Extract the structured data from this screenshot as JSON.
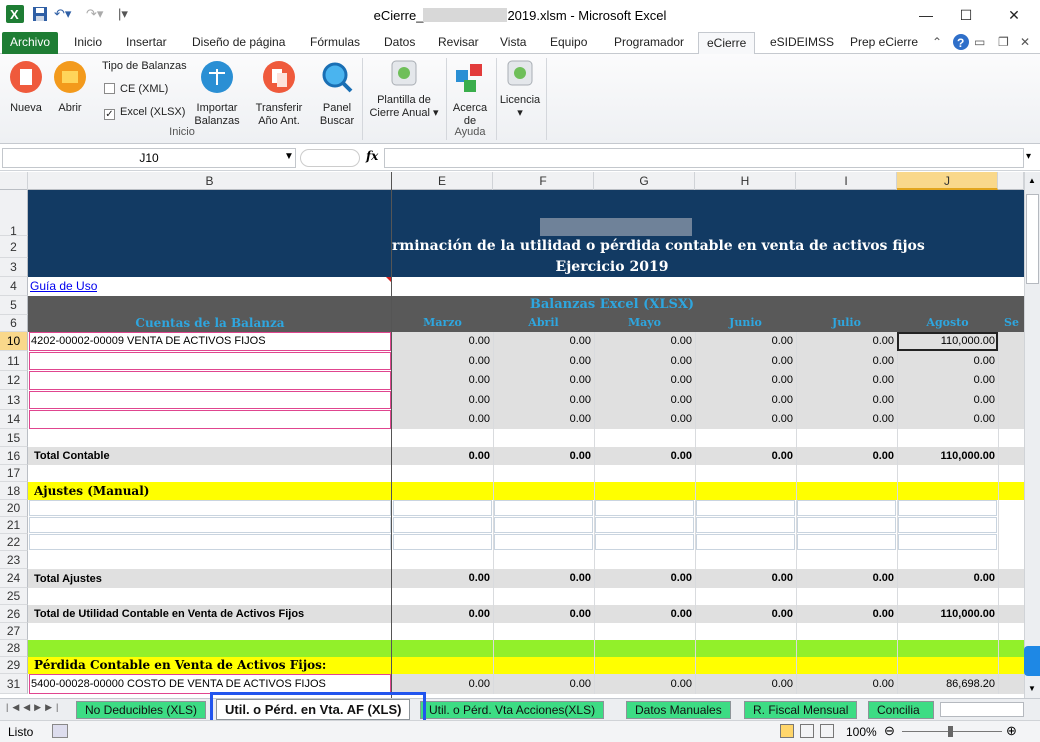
{
  "window": {
    "title_prefix": "eCierre_",
    "title_suffix": "2019.xlsm - Microsoft Excel",
    "minimize": "—",
    "maximize": "☐",
    "close": "✕"
  },
  "ribbon_tabs": [
    "Archivo",
    "Inicio",
    "Insertar",
    "Diseño de página",
    "Fórmulas",
    "Datos",
    "Revisar",
    "Vista",
    "Equipo",
    "Programador",
    "eCierre",
    "eSIDEIMSS",
    "Prep eCierre"
  ],
  "active_tab": "eCierre",
  "ribbon": {
    "nueva": "Nueva",
    "abrir": "Abrir",
    "tipo_balanzas": "Tipo de Balanzas",
    "ce_xml": "CE (XML)",
    "excel_xlsx": "Excel (XLSX)",
    "importar": [
      "Importar",
      "Balanzas"
    ],
    "transferir": [
      "Transferir",
      "Año Ant."
    ],
    "panel": [
      "Panel",
      "Buscar"
    ],
    "group_inicio": "Inicio",
    "plantilla": [
      "Plantilla de",
      "Cierre Anual ▾"
    ],
    "acerca": [
      "Acerca",
      "de"
    ],
    "group_ayuda": "Ayuda",
    "licencia": "Licencia",
    "licencia_arrow": "▾"
  },
  "formula_bar": {
    "name_box": "J10",
    "fx": "fx",
    "formula": ""
  },
  "columns": [
    "B",
    "E",
    "F",
    "G",
    "H",
    "I",
    "J"
  ],
  "sheet": {
    "header_line2": "rminación de la utilidad o pérdida contable en venta de activos fijos",
    "header_line3": "Ejercicio 2019",
    "guia": "Guía de Uso",
    "balanzas_title": "Balanzas Excel (XLSX)",
    "cuentas_header": "Cuentas de la Balanza",
    "months": [
      "Marzo",
      "Abril",
      "Mayo",
      "Junio",
      "Julio",
      "Agosto",
      "Se"
    ],
    "row10_label": "4202-00002-00009 VENTA DE ACTIVOS FIJOS",
    "row10_values": [
      "0.00",
      "0.00",
      "0.00",
      "0.00",
      "0.00",
      "110,000.00"
    ],
    "zero_values": [
      "0.00",
      "0.00",
      "0.00",
      "0.00",
      "0.00",
      "0.00"
    ],
    "total_contable": "Total Contable",
    "total_contable_values": [
      "0.00",
      "0.00",
      "0.00",
      "0.00",
      "0.00",
      "110,000.00"
    ],
    "ajustes": "Ajustes  (Manual)",
    "total_ajustes": "Total Ajustes",
    "total_ajustes_values": [
      "0.00",
      "0.00",
      "0.00",
      "0.00",
      "0.00",
      "0.00"
    ],
    "total_utilidad": "Total de Utilidad Contable en Venta de Activos Fijos",
    "total_utilidad_values": [
      "0.00",
      "0.00",
      "0.00",
      "0.00",
      "0.00",
      "110,000.00"
    ],
    "perdida": "Pérdida Contable en Venta de Activos Fijos:",
    "row31_label": "5400-00028-00000 COSTO DE VENTA DE ACTIVOS FIJOS",
    "row31_values": [
      "0.00",
      "0.00",
      "0.00",
      "0.00",
      "0.00",
      "86,698.20"
    ]
  },
  "row_numbers": [
    "1",
    "2",
    "3",
    "4",
    "5",
    "6",
    "10",
    "11",
    "12",
    "13",
    "14",
    "15",
    "16",
    "17",
    "18",
    "20",
    "21",
    "22",
    "23",
    "24",
    "25",
    "26",
    "27",
    "28",
    "29",
    "31"
  ],
  "sheet_tabs": [
    "No Deducibles (XLS)",
    "Util. o Pérd. en Vta. AF (XLS)",
    "Util. o Pérd. Vta Acciones(XLS)",
    "Datos Manuales",
    "R. Fiscal Mensual",
    "Concilia"
  ],
  "active_sheet": "Util. o Pérd. en Vta. AF (XLS)",
  "status": {
    "ready": "Listo",
    "zoom": "100%"
  },
  "colors": {
    "header_navy": "#123a63",
    "dark_gray": "#595959",
    "yellow": "#ffff00",
    "lime": "#92f02a",
    "cyan_text": "#2ea6df",
    "highlight": "#2255ee"
  }
}
